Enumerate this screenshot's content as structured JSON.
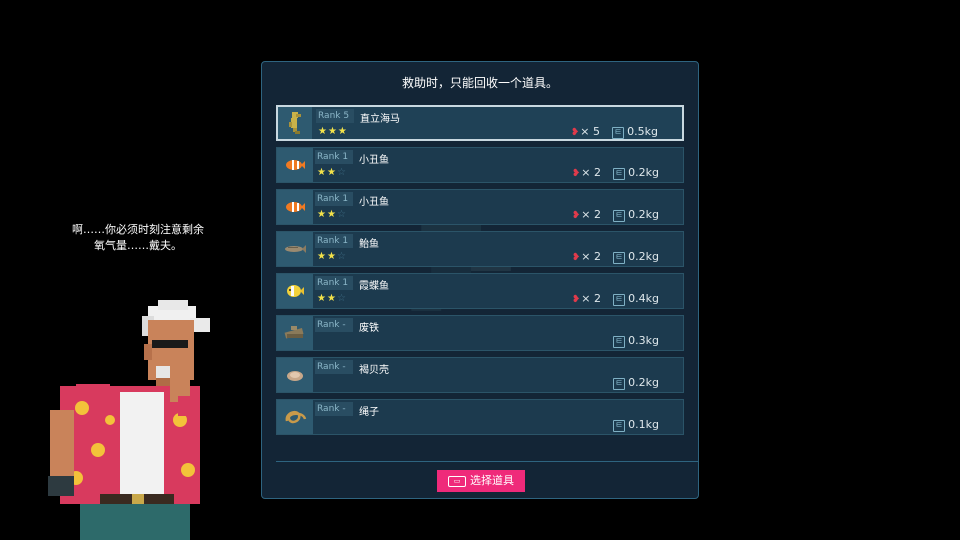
{
  "dialogue": {
    "line1": "啊……你必须时刻注意剩余",
    "line2": "氧气量……戴夫。"
  },
  "panel": {
    "title": "救助时，只能回收一个道具。",
    "select_button": "选择道具"
  },
  "items": [
    {
      "rank": "Rank 5",
      "name": "直立海马",
      "stars": 3,
      "count": "× 5",
      "weight": "0.5kg",
      "icon": "seahorse-icon",
      "selected": true
    },
    {
      "rank": "Rank 1",
      "name": "小丑鱼",
      "stars": 2,
      "count": "× 2",
      "weight": "0.2kg",
      "icon": "clownfish-icon"
    },
    {
      "rank": "Rank 1",
      "name": "小丑鱼",
      "stars": 2,
      "count": "× 2",
      "weight": "0.2kg",
      "icon": "clownfish-icon"
    },
    {
      "rank": "Rank 1",
      "name": "鲐鱼",
      "stars": 2,
      "count": "× 2",
      "weight": "0.2kg",
      "icon": "mackerel-icon"
    },
    {
      "rank": "Rank 1",
      "name": "霞蝶鱼",
      "stars": 2,
      "count": "× 2",
      "weight": "0.4kg",
      "icon": "butterflyfish-icon"
    },
    {
      "rank": "Rank -",
      "name": "废铁",
      "stars": 0,
      "count": "",
      "weight": "0.3kg",
      "icon": "scrap-iron-icon"
    },
    {
      "rank": "Rank -",
      "name": "褐贝壳",
      "stars": 0,
      "count": "",
      "weight": "0.2kg",
      "icon": "brown-shell-icon"
    },
    {
      "rank": "Rank -",
      "name": "绳子",
      "stars": 0,
      "count": "",
      "weight": "0.1kg",
      "icon": "rope-icon"
    }
  ],
  "colors": {
    "accent": "#ef2a7a",
    "star": "#f2e14a",
    "panel_bg": "#132536",
    "row_bg": "#1c3a4e"
  }
}
